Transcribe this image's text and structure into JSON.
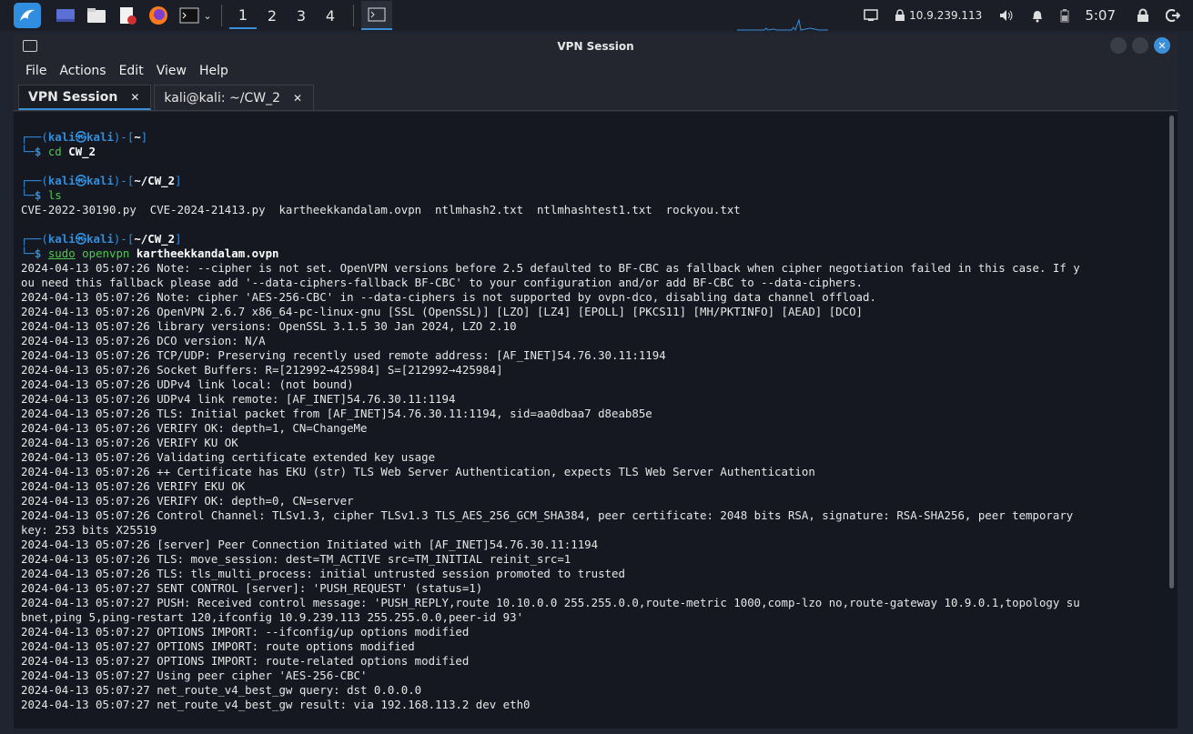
{
  "taskbar": {
    "workspaces": [
      "1",
      "2",
      "3",
      "4"
    ],
    "active_workspace": "1",
    "ip_address": "10.9.239.113",
    "clock": "5:07"
  },
  "window": {
    "title": "VPN Session",
    "menu": [
      "File",
      "Actions",
      "Edit",
      "View",
      "Help"
    ],
    "tabs": [
      {
        "label": "VPN Session",
        "close": "✕"
      },
      {
        "label": "kali@kali: ~/CW_2",
        "close": "✕"
      }
    ]
  },
  "terminal": {
    "user": "kali",
    "host": "kali",
    "at": "㉿",
    "sessions": [
      {
        "path": "~",
        "sudo": "",
        "cmd": "cd",
        "arg": "CW_2"
      },
      {
        "path": "~/CW_2",
        "sudo": "",
        "cmd": "ls",
        "arg": ""
      },
      {
        "path": "~/CW_2",
        "sudo": "sudo",
        "cmd": "openvpn",
        "arg": "kartheekkandalam.ovpn"
      }
    ],
    "ls_output": "CVE-2022-30190.py  CVE-2024-21413.py  kartheekkandalam.ovpn  ntlmhash2.txt  ntlmhashtest1.txt  rockyou.txt",
    "log": [
      "2024-04-13 05:07:26 Note: --cipher is not set. OpenVPN versions before 2.5 defaulted to BF-CBC as fallback when cipher negotiation failed in this case. If y",
      "ou need this fallback please add '--data-ciphers-fallback BF-CBC' to your configuration and/or add BF-CBC to --data-ciphers.",
      "2024-04-13 05:07:26 Note: cipher 'AES-256-CBC' in --data-ciphers is not supported by ovpn-dco, disabling data channel offload.",
      "2024-04-13 05:07:26 OpenVPN 2.6.7 x86_64-pc-linux-gnu [SSL (OpenSSL)] [LZO] [LZ4] [EPOLL] [PKCS11] [MH/PKTINFO] [AEAD] [DCO]",
      "2024-04-13 05:07:26 library versions: OpenSSL 3.1.5 30 Jan 2024, LZO 2.10",
      "2024-04-13 05:07:26 DCO version: N/A",
      "2024-04-13 05:07:26 TCP/UDP: Preserving recently used remote address: [AF_INET]54.76.30.11:1194",
      "2024-04-13 05:07:26 Socket Buffers: R=[212992→425984] S=[212992→425984]",
      "2024-04-13 05:07:26 UDPv4 link local: (not bound)",
      "2024-04-13 05:07:26 UDPv4 link remote: [AF_INET]54.76.30.11:1194",
      "2024-04-13 05:07:26 TLS: Initial packet from [AF_INET]54.76.30.11:1194, sid=aa0dbaa7 d8eab85e",
      "2024-04-13 05:07:26 VERIFY OK: depth=1, CN=ChangeMe",
      "2024-04-13 05:07:26 VERIFY KU OK",
      "2024-04-13 05:07:26 Validating certificate extended key usage",
      "2024-04-13 05:07:26 ++ Certificate has EKU (str) TLS Web Server Authentication, expects TLS Web Server Authentication",
      "2024-04-13 05:07:26 VERIFY EKU OK",
      "2024-04-13 05:07:26 VERIFY OK: depth=0, CN=server",
      "2024-04-13 05:07:26 Control Channel: TLSv1.3, cipher TLSv1.3 TLS_AES_256_GCM_SHA384, peer certificate: 2048 bits RSA, signature: RSA-SHA256, peer temporary",
      "key: 253 bits X25519",
      "2024-04-13 05:07:26 [server] Peer Connection Initiated with [AF_INET]54.76.30.11:1194",
      "2024-04-13 05:07:26 TLS: move_session: dest=TM_ACTIVE src=TM_INITIAL reinit_src=1",
      "2024-04-13 05:07:26 TLS: tls_multi_process: initial untrusted session promoted to trusted",
      "2024-04-13 05:07:27 SENT CONTROL [server]: 'PUSH_REQUEST' (status=1)",
      "2024-04-13 05:07:27 PUSH: Received control message: 'PUSH_REPLY,route 10.10.0.0 255.255.0.0,route-metric 1000,comp-lzo no,route-gateway 10.9.0.1,topology su",
      "bnet,ping 5,ping-restart 120,ifconfig 10.9.239.113 255.255.0.0,peer-id 93'",
      "2024-04-13 05:07:27 OPTIONS IMPORT: --ifconfig/up options modified",
      "2024-04-13 05:07:27 OPTIONS IMPORT: route options modified",
      "2024-04-13 05:07:27 OPTIONS IMPORT: route-related options modified",
      "2024-04-13 05:07:27 Using peer cipher 'AES-256-CBC'",
      "2024-04-13 05:07:27 net_route_v4_best_gw query: dst 0.0.0.0",
      "2024-04-13 05:07:27 net_route_v4_best_gw result: via 192.168.113.2 dev eth0"
    ]
  }
}
